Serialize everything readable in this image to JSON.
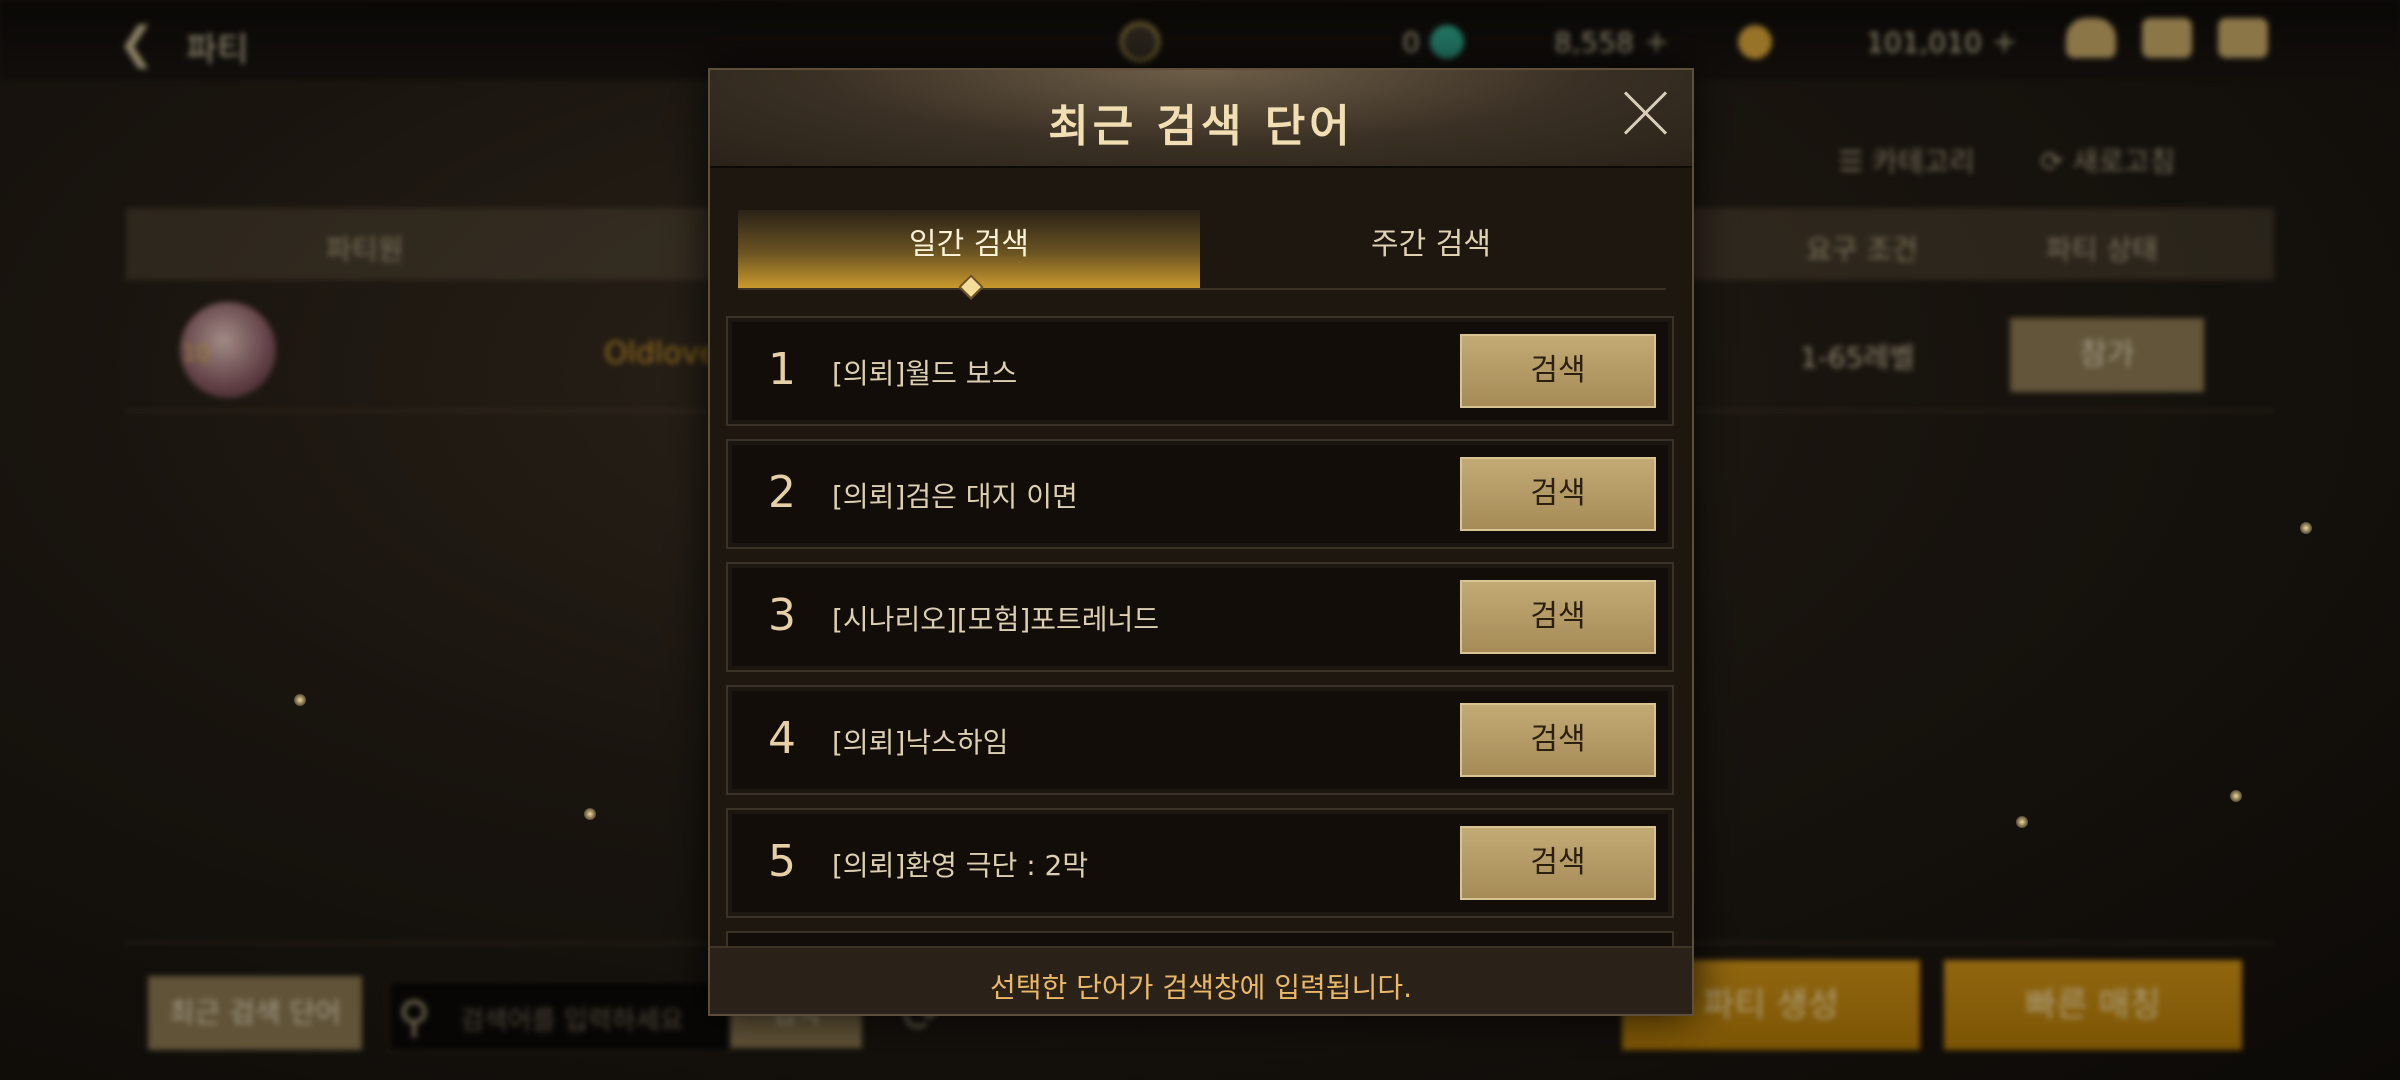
{
  "topbar": {
    "title": "파티",
    "currencies": [
      {
        "icon": "moon-coin-icon",
        "value": "0"
      },
      {
        "icon": "gem-icon",
        "value": "8,558"
      },
      {
        "icon": "gold-coin-icon",
        "value": "101,010"
      }
    ],
    "plus": "+"
  },
  "filters": {
    "category": "카테고리",
    "refresh": "새로고침"
  },
  "table": {
    "headers": [
      "파티원",
      "요구 조건",
      "파티 상태"
    ],
    "row": {
      "leader_name": "Oldlove",
      "level_badge": "10",
      "requirement": "1-65레벨",
      "join": "참가"
    }
  },
  "bottom": {
    "recent_button": "최근 검색 단어",
    "search_placeholder": "검색어를 입력하세요",
    "search_button": "검색",
    "create_party": "파티 생성",
    "quick_match": "빠른 매칭"
  },
  "modal": {
    "title": "최근 검색 단어",
    "tabs": [
      {
        "label": "일간 검색",
        "active": true
      },
      {
        "label": "주간 검색",
        "active": false
      }
    ],
    "items": [
      {
        "rank": "1",
        "label": "[의뢰]월드 보스",
        "button": "검색"
      },
      {
        "rank": "2",
        "label": "[의뢰]검은 대지 이면",
        "button": "검색"
      },
      {
        "rank": "3",
        "label": "[시나리오][모험]포트레너드",
        "button": "검색"
      },
      {
        "rank": "4",
        "label": "[의뢰]낙스하임",
        "button": "검색"
      },
      {
        "rank": "5",
        "label": "[의뢰]환영 극단 : 2막",
        "button": "검색"
      }
    ],
    "footer": "선택한 단어가 검색창에 입력됩니다."
  }
}
